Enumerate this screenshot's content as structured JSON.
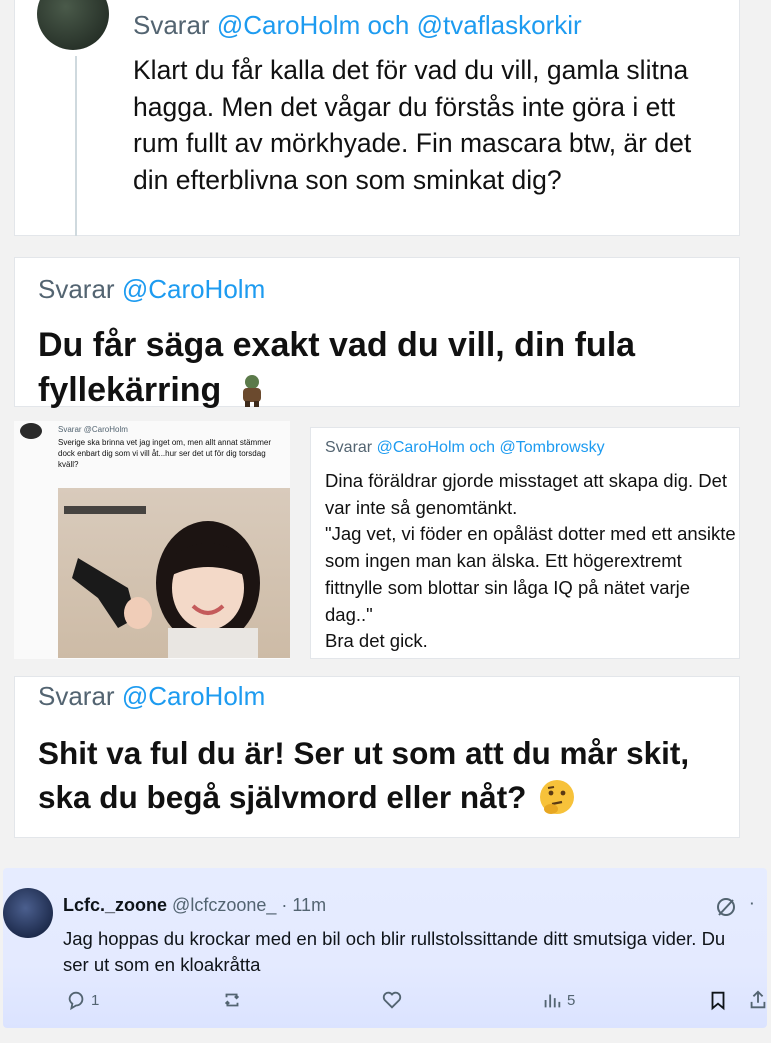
{
  "card1": {
    "reply_prefix": "Svarar",
    "reply_mentions": "@CaroHolm och @tvaflaskorkir",
    "text": "Klart du får kalla det för vad du vill, gamla slitna hagga. Men det vågar du förstås inte göra i ett rum fullt av mörkhyade. Fin mascara btw, är det din efterblivna son som sminkat dig?"
  },
  "card2": {
    "reply_prefix": "Svarar",
    "reply_mentions": "@CaroHolm",
    "text": "Du får säga exakt vad du vill, din fula fyllekärring"
  },
  "card3a": {
    "reply_line": "Svarar @CaroHolm",
    "text": "Sverige ska brinna vet jag inget om, men allt annat stämmer dock enbart dig som vi vill åt...hur ser det ut för dig torsdag kväll?"
  },
  "card3b": {
    "reply_prefix": "Svarar",
    "reply_mentions": "@CaroHolm och @Tombrowsky",
    "text": "Dina föräldrar gjorde misstaget att skapa dig. Det var inte så genomtänkt.\n\"Jag vet, vi föder en opåläst dotter med ett ansikte som ingen man kan älska. Ett högerextremt fittnylle som blottar sin låga IQ på nätet varje dag..\"\nBra det gick."
  },
  "card4": {
    "reply_prefix": "Svarar",
    "reply_mentions": "@CaroHolm",
    "text": "Shit va ful du är! Ser ut som att du mår skit, ska du begå självmord eller nåt?"
  },
  "tweet": {
    "name": "Lcfc._zoone",
    "handle": "@lcfczoone_",
    "time": "· 11m",
    "text": "Jag hoppas du krockar med en bil och blir rullstolssittande ditt smutsiga vider. Du ser ut som en kloakråtta",
    "reply_count": "1",
    "views_count": "5"
  },
  "colors": {
    "mention": "#1d9bf0",
    "muted": "#536471",
    "tweet_bg": "#e4eaff"
  }
}
